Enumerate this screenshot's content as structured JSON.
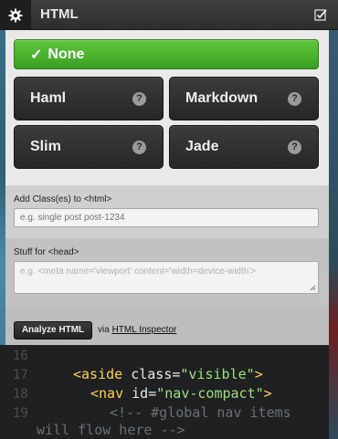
{
  "header": {
    "title": "HTML",
    "settings_icon": "gear-icon",
    "toggle_icon": "checkbox-icon"
  },
  "preprocessor": {
    "none_label": "None",
    "none_check": "✓",
    "options": [
      {
        "label": "Haml",
        "help": "?"
      },
      {
        "label": "Markdown",
        "help": "?"
      },
      {
        "label": "Slim",
        "help": "?"
      },
      {
        "label": "Jade",
        "help": "?"
      }
    ]
  },
  "html_class": {
    "label": "Add Class(es) to <html>",
    "placeholder": "e.g. single post post-1234",
    "value": ""
  },
  "head": {
    "label": "Stuff for <head>",
    "placeholder": "e.g. <meta name='viewport' content='width=device-width'>",
    "value": ""
  },
  "analyze": {
    "button_label": "Analyze HTML",
    "via": "via",
    "link_label": "HTML Inspector"
  },
  "code": {
    "lines": [
      {
        "num": "16",
        "text": ""
      },
      {
        "num": "17",
        "tag_open": "<aside",
        "attr": " class=",
        "str": "\"visible\"",
        "tag_close": ">"
      },
      {
        "num": "18",
        "tag_open": "<nav",
        "attr": " id=",
        "str": "\"nav-compact\"",
        "tag_close": ">"
      },
      {
        "num": "19",
        "comment": "<!-- #global nav items"
      },
      {
        "num": "",
        "comment": "will flow here -->"
      }
    ]
  },
  "colors": {
    "accent_green": "#4cb52f",
    "button_dark": "#2e2e2e",
    "tag_yellow": "#ffd24a",
    "string_green": "#9fe07a"
  }
}
